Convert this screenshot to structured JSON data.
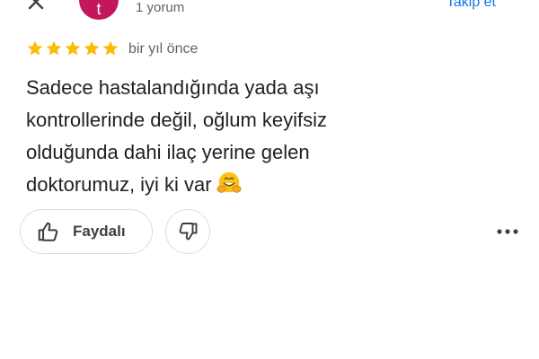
{
  "header": {
    "avatar_initial": "t",
    "avatar_color": "#c2185b",
    "review_count": "1 yorum",
    "follow_label": "Takip et",
    "close_icon": "close-icon"
  },
  "review": {
    "rating": 5,
    "rating_max": 5,
    "star_color": "#fbbc04",
    "time_ago": "bir yıl önce",
    "text": "Sadece hastalandığında yada aşı\nkontrollerinde değil, oğlum keyifsiz\nolduğunda dahi ilaç yerine gelen\ndoktorumuz, iyi ki var",
    "emoji": "hugging-face"
  },
  "actions": {
    "helpful_label": "Faydalı",
    "helpful_icon": "thumb-up-icon",
    "unhelpful_icon": "thumb-down-icon",
    "more_icon": "more-options-icon"
  }
}
